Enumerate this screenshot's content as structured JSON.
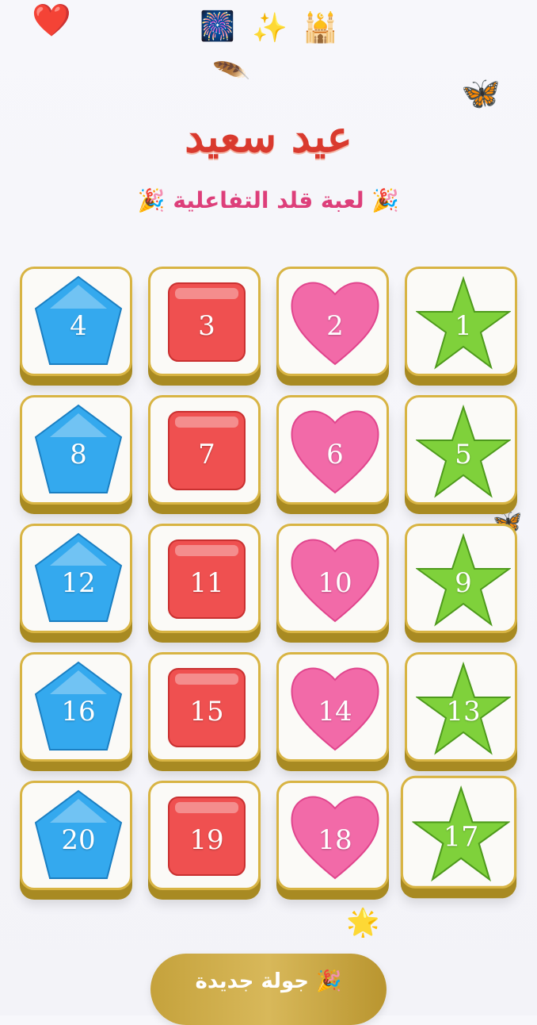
{
  "decorations": {
    "top_icons": [
      "🎆",
      "✨",
      "🕌"
    ],
    "heart": "❤️",
    "feather": "🪶",
    "butterfly": "🦋",
    "star": "🌟"
  },
  "header": {
    "title": "عيد سعيد",
    "subtitle": "🎉 لعبة قلد التفاعلية 🎉"
  },
  "colors": {
    "star": "#7fd13b",
    "heart": "#f26aa8",
    "square": "#ef5050",
    "pentagon": "#34a9ee",
    "tile_border": "#d8b443"
  },
  "tiles": [
    {
      "number": "1",
      "shape": "star"
    },
    {
      "number": "2",
      "shape": "heart"
    },
    {
      "number": "3",
      "shape": "square"
    },
    {
      "number": "4",
      "shape": "pentagon"
    },
    {
      "number": "5",
      "shape": "star"
    },
    {
      "number": "6",
      "shape": "heart"
    },
    {
      "number": "7",
      "shape": "square"
    },
    {
      "number": "8",
      "shape": "pentagon"
    },
    {
      "number": "9",
      "shape": "star"
    },
    {
      "number": "10",
      "shape": "heart"
    },
    {
      "number": "11",
      "shape": "square"
    },
    {
      "number": "12",
      "shape": "pentagon"
    },
    {
      "number": "13",
      "shape": "star"
    },
    {
      "number": "14",
      "shape": "heart"
    },
    {
      "number": "15",
      "shape": "square"
    },
    {
      "number": "16",
      "shape": "pentagon"
    },
    {
      "number": "17",
      "shape": "star",
      "selected": true
    },
    {
      "number": "18",
      "shape": "heart"
    },
    {
      "number": "19",
      "shape": "square"
    },
    {
      "number": "20",
      "shape": "pentagon"
    }
  ],
  "footer": {
    "new_round_label": "جولة جديدة 🎉"
  }
}
